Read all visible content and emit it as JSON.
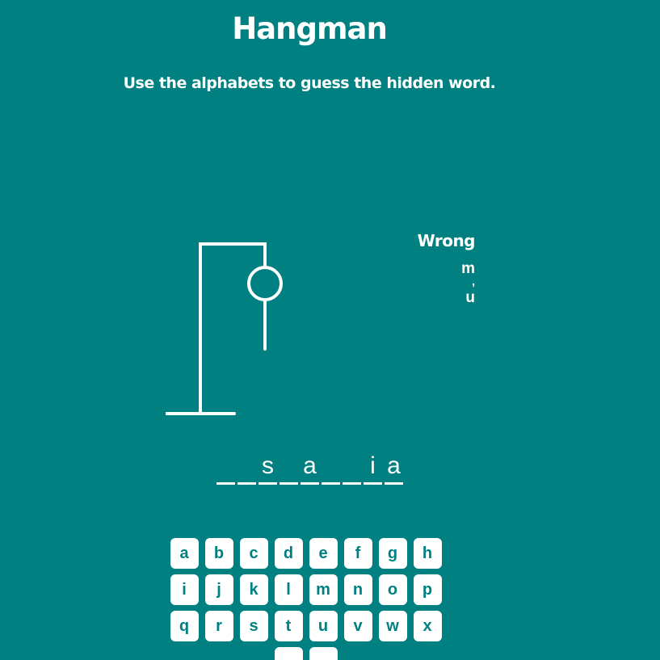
{
  "header": {
    "title": "Hangman",
    "instructions": "Use the alphabets to guess the hidden word."
  },
  "wrong_guesses": {
    "title": "Wrong",
    "letters": [
      "m",
      "u"
    ],
    "separator": ","
  },
  "word_slots": [
    "",
    "",
    "s",
    "",
    "a",
    "",
    "",
    "i",
    "a"
  ],
  "keyboard": {
    "rows": [
      [
        "a",
        "b",
        "c",
        "d",
        "e",
        "f",
        "g",
        "h"
      ],
      [
        "i",
        "j",
        "k",
        "l",
        "m",
        "n",
        "o",
        "p"
      ],
      [
        "q",
        "r",
        "s",
        "t",
        "u",
        "v",
        "w",
        "x"
      ],
      [
        "",
        ""
      ]
    ]
  },
  "colors": {
    "background": "#008080",
    "foreground": "#ffffff",
    "key_text": "#008080"
  },
  "hangman_parts_drawn": [
    "head",
    "body"
  ]
}
